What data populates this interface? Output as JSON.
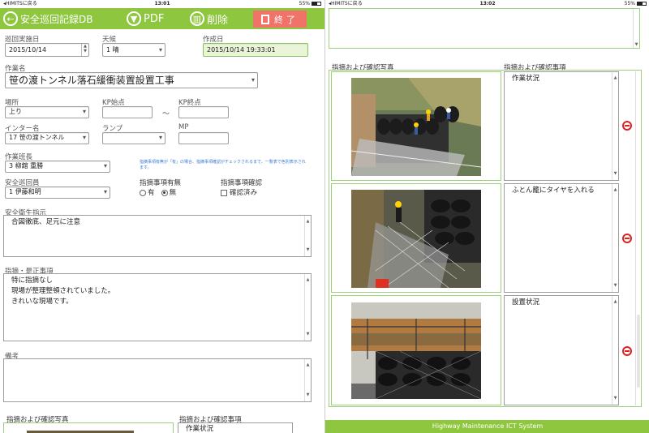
{
  "left": {
    "status": {
      "carrier": "◂HIMITSに戻る",
      "time": "13:01",
      "battery": "55%",
      "battery_level": 0.55
    },
    "toolbar": {
      "title": "安全巡回記録DB",
      "pdf": "PDF",
      "delete": "削除",
      "end": "終了"
    },
    "patrol_date": {
      "label": "巡回実施日",
      "value": "2015/10/14"
    },
    "weather": {
      "label": "天候",
      "value": "1 晴"
    },
    "created": {
      "label": "作成日",
      "value": "2015/10/14 19:33:01"
    },
    "work_name": {
      "label": "作業名",
      "value": "笹の渡トンネル落石緩衝装置設置工事"
    },
    "place": {
      "label": "場所",
      "value": "上り"
    },
    "kp_start": {
      "label": "KP始点",
      "value": ""
    },
    "kp_sep": "～",
    "kp_end": {
      "label": "KP終点",
      "value": ""
    },
    "interchange": {
      "label": "インター名",
      "value": "17 笹の渡トンネル"
    },
    "ramp": {
      "label": "ランプ",
      "value": ""
    },
    "mp": {
      "label": "MP",
      "value": ""
    },
    "leader": {
      "label": "作業班長",
      "value": "3 柳舘 重勝"
    },
    "hint": "指摘事項有無が「有」の場合、指摘事項確認がチェックされるまで、一覧表で色別表示されます。",
    "issues_flag": {
      "label": "指摘事項有無",
      "yes": "有",
      "no": "無",
      "selected": "no"
    },
    "issues_confirm": {
      "label": "指摘事項確認",
      "check": "確認済み",
      "checked": false
    },
    "inspector": {
      "label": "安全巡回員",
      "value": "1 伊藤和明"
    },
    "safety": {
      "label": "安全衛生指示",
      "text": "合図徹底、足元に注意"
    },
    "corrections": {
      "label": "指摘・是正事項",
      "lines": [
        "特に指摘なし",
        "現場が整理整頓されていました。",
        "きれいな現場です。"
      ]
    },
    "notes": {
      "label": "備考",
      "text": ""
    },
    "photos_label": "指摘および確認写真",
    "items_label": "指摘および確認事項",
    "bottom_item": "作業状況"
  },
  "right": {
    "status": {
      "carrier": "◂HIMITSに戻る",
      "time": "13:02",
      "battery": "55%",
      "battery_level": 0.55
    },
    "photos_label": "指摘および確認写真",
    "items_label": "指摘および確認事項",
    "rows": [
      {
        "photo": "construction-site-tires-photo",
        "text": "作業状況"
      },
      {
        "photo": "gabion-tire-installation-photo",
        "text": "ふとん籠にタイヤを入れる"
      },
      {
        "photo": "installed-barrier-photo",
        "text": "設置状況"
      }
    ],
    "footer": "Highway Maintenance ICT System"
  },
  "colors": {
    "accent": "#8ec63f",
    "end_button": "#f0736a",
    "remove": "#e02020",
    "border": "#9ed07b"
  }
}
